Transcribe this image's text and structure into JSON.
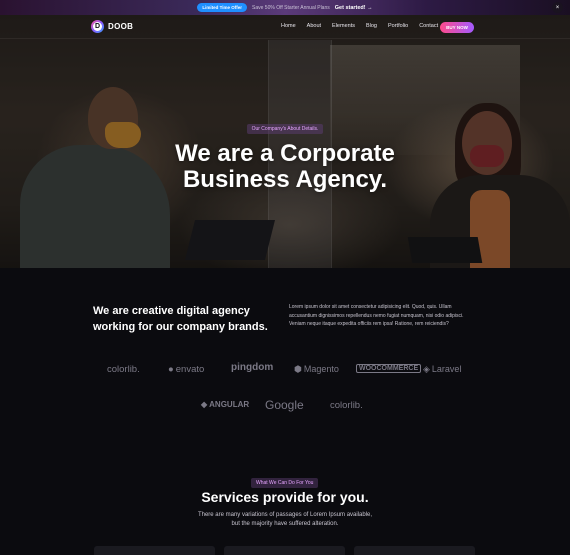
{
  "topbar": {
    "badge": "Limited Time Offer",
    "text": "Save 50% Off Starter Annual Plans",
    "cta": "Get started! →",
    "close_glyph": "×"
  },
  "nav": {
    "logo_letter": "D",
    "logo_text": "DOOB",
    "items": [
      "Home",
      "About",
      "Elements",
      "Blog",
      "Portfolio",
      "Contact"
    ],
    "buy_label": "BUY NOW"
  },
  "hero": {
    "tag": "Our Company's About Details.",
    "title_line1": "We are a Corporate",
    "title_line2": "Business Agency."
  },
  "intro": {
    "heading": "We are creative digital agency working for our company brands.",
    "paragraph": "Lorem ipsum dolor sit amet consectetur adipisicing elit. Quod, quis. Ullam accusantium dignissimos repellendus nemo fugiat numquam, nisi odio adipisci. Veniam neque itaque expedita officiis rem ipsa! Ratione, rem reiciendis?"
  },
  "brands": {
    "row1": [
      "colorlib.",
      "envato",
      "pingdom",
      "Magento",
      "WOOCOMMERCE",
      "Laravel"
    ],
    "row2": [
      "ANGULAR",
      "Google",
      "colorlib."
    ]
  },
  "services": {
    "tag": "What We Can Do For You",
    "title": "Services provide for you.",
    "desc_line1": "There are many variations of passages of Lorem Ipsum available,",
    "desc_line2": "but the majority have suffered alteration."
  },
  "colors": {
    "accent_gradient_start": "#ff4b8b",
    "accent_gradient_end": "#a35bff",
    "badge_blue": "#1f8fff",
    "background": "#0b0b0f"
  }
}
